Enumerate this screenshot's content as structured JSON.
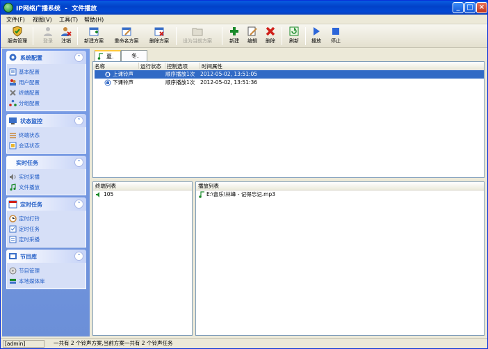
{
  "window": {
    "title": "IP网络广播系统  -  文件播放"
  },
  "menu": [
    "文件(F)",
    "视图(V)",
    "工具(T)",
    "帮助(H)"
  ],
  "toolbar": {
    "service": "服务管理",
    "login": "登录",
    "logout": "注销",
    "new_plan": "新建方案",
    "rename_plan": "重命名方案",
    "delete_plan": "删除方案",
    "set_current": "设为当前方案",
    "new": "新建",
    "edit": "编辑",
    "delete": "删除",
    "refresh": "刷新",
    "play": "播放",
    "stop": "停止"
  },
  "sidebar": {
    "system": {
      "title": "系统配置",
      "items": [
        "基本配置",
        "用户配置",
        "终端配置",
        "分组配置"
      ]
    },
    "status": {
      "title": "状态监控",
      "items": [
        "终端状态",
        "会话状态"
      ]
    },
    "realtime": {
      "title": "实时任务",
      "items": [
        "实时采播",
        "文件播放"
      ]
    },
    "timed": {
      "title": "定时任务",
      "items": [
        "定时打铃",
        "定时任务",
        "定时采播"
      ]
    },
    "library": {
      "title": "节目库",
      "items": [
        "节目管理",
        "本地媒体库"
      ]
    }
  },
  "tabs": [
    "夏.",
    "冬."
  ],
  "grid": {
    "headers": [
      "名称",
      "运行状态",
      "控制选项",
      "时间属性"
    ],
    "rows": [
      {
        "name": "上课铃声",
        "status": "",
        "control": "顺序播放1次",
        "time": "2012-05-02, 13:51:05",
        "selected": true
      },
      {
        "name": "下课铃声",
        "status": "",
        "control": "顺序播放1次",
        "time": "2012-05-02, 13:51:36",
        "selected": false
      }
    ]
  },
  "terminals": {
    "header": "终端列表",
    "items": [
      "105"
    ]
  },
  "playlist": {
    "header": "播放列表",
    "items": [
      "E:\\音乐\\林峰 - 记得忘记.mp3"
    ]
  },
  "status": {
    "user": "[admin]",
    "message": "一共有 2 个铃声方案,当前方案一共有 2 个铃声任务"
  }
}
